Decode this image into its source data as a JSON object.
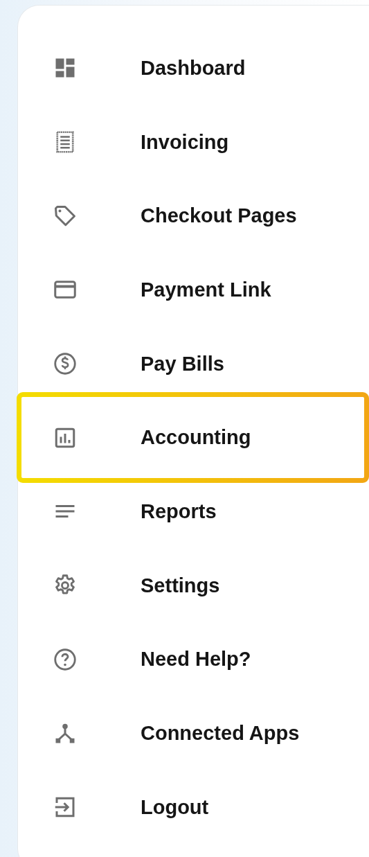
{
  "menu": {
    "items": [
      {
        "kind": "dashboard",
        "label": "Dashboard",
        "selected": false
      },
      {
        "kind": "receipt",
        "label": "Invoicing",
        "selected": false
      },
      {
        "kind": "tag",
        "label": "Checkout Pages",
        "selected": false
      },
      {
        "kind": "card",
        "label": "Payment Link",
        "selected": false
      },
      {
        "kind": "dollar",
        "label": "Pay Bills",
        "selected": false
      },
      {
        "kind": "chart",
        "label": "Accounting",
        "selected": true
      },
      {
        "kind": "lines",
        "label": "Reports",
        "selected": false
      },
      {
        "kind": "gear",
        "label": "Settings",
        "selected": false
      },
      {
        "kind": "help",
        "label": "Need Help?",
        "selected": false
      },
      {
        "kind": "network",
        "label": "Connected Apps",
        "selected": false
      },
      {
        "kind": "logout",
        "label": "Logout",
        "selected": false
      }
    ]
  }
}
